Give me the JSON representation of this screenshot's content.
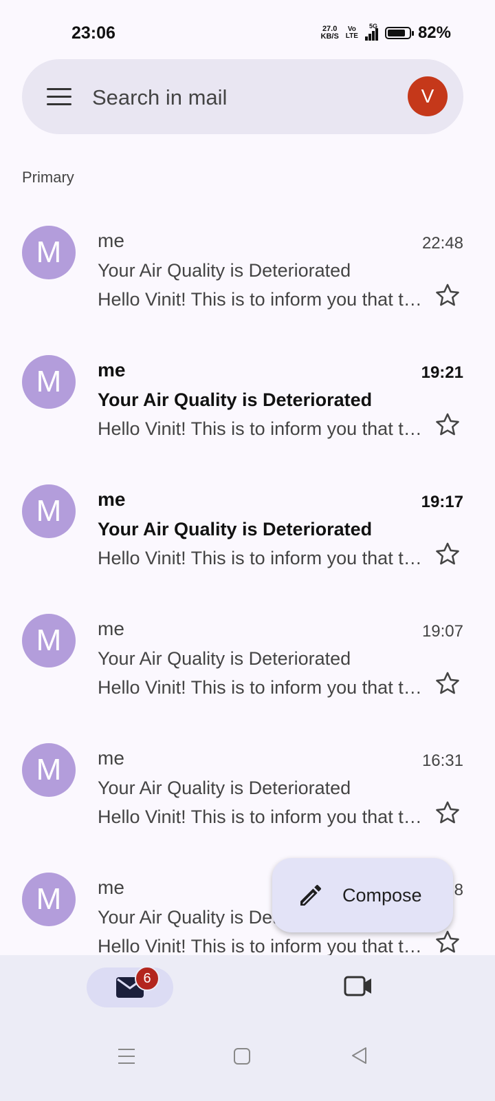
{
  "status_bar": {
    "time": "23:06",
    "net_speed_value": "27.0",
    "net_speed_unit": "KB/S",
    "volte_top": "Vo",
    "volte_bottom": "LTE",
    "network_type": "5G",
    "battery_percent": "82%",
    "battery_level": 0.82
  },
  "search": {
    "placeholder": "Search in mail",
    "account_initial": "V",
    "account_color": "#c5381a"
  },
  "section_label": "Primary",
  "mails": [
    {
      "avatar": "M",
      "sender": "me",
      "time": "22:48",
      "subject": "Your Air Quality is Deteriorated",
      "snippet": "Hello Vinit! This is to inform you that the air quality in your area has deteriorated",
      "unread": false
    },
    {
      "avatar": "M",
      "sender": "me",
      "time": "19:21",
      "subject": "Your Air Quality is Deteriorated",
      "snippet": "Hello Vinit! This is to inform you that the air quality in your area has deteriorated",
      "unread": true
    },
    {
      "avatar": "M",
      "sender": "me",
      "time": "19:17",
      "subject": "Your Air Quality is Deteriorated",
      "snippet": "Hello Vinit! This is to inform you that the air quality in your area has deteriorated",
      "unread": true
    },
    {
      "avatar": "M",
      "sender": "me",
      "time": "19:07",
      "subject": "Your Air Quality is Deteriorated",
      "snippet": "Hello Vinit! This is to inform you that the air quality in your area has deteriorated",
      "unread": false
    },
    {
      "avatar": "M",
      "sender": "me",
      "time": "16:31",
      "subject": "Your Air Quality is Deteriorated",
      "snippet": "Hello Vinit! This is to inform you that the air quality in your area has deteriorated",
      "unread": false
    },
    {
      "avatar": "M",
      "sender": "me",
      "time": "8",
      "subject": "Your Air Quality is Deteriorated",
      "snippet": "Hello Vinit! This is to inform you that the air quality in your area has deteriorated",
      "unread": false
    }
  ],
  "compose": {
    "label": "Compose",
    "icon": "pencil-icon"
  },
  "bottom_nav": {
    "mail_badge": "6",
    "mail_icon": "mail-icon",
    "meet_icon": "video-camera-icon"
  },
  "colors": {
    "background": "#fbf8fe",
    "avatar_purple": "#b39ddb",
    "badge_red": "#b3261e",
    "compose_bg": "#e3e3f7"
  }
}
